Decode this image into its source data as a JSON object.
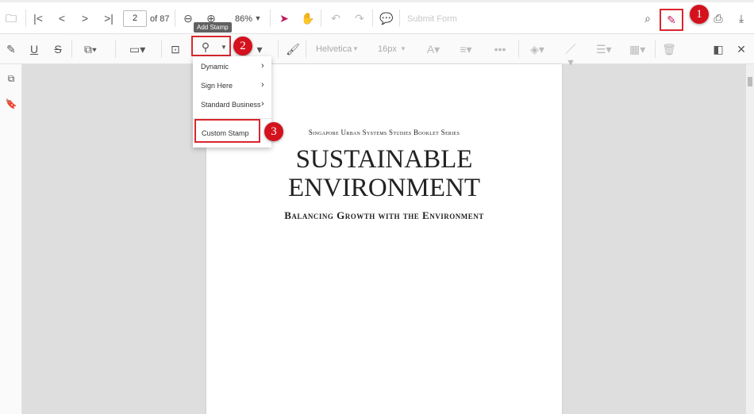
{
  "toolbar": {
    "page_current": "2",
    "page_total": "of 87",
    "zoom": "86%",
    "submit_form": "Submit Form"
  },
  "annot_toolbar": {
    "font": "Helvetica",
    "font_size": "16px",
    "tooltip": "Add Stamp"
  },
  "stamp_menu": {
    "items": [
      {
        "label": "Dynamic"
      },
      {
        "label": "Sign Here"
      },
      {
        "label": "Standard Business"
      }
    ],
    "custom": "Custom Stamp"
  },
  "badges": [
    "1",
    "2",
    "3"
  ],
  "document": {
    "series": "Singapore Urban Systems Studies Booklet Series",
    "title_line1": "SUSTAINABLE",
    "title_line2": "ENVIRONMENT",
    "subtitle": "Balancing Growth with the Environment"
  },
  "colors": {
    "accent": "#c2185b",
    "highlight": "#d9272e"
  }
}
